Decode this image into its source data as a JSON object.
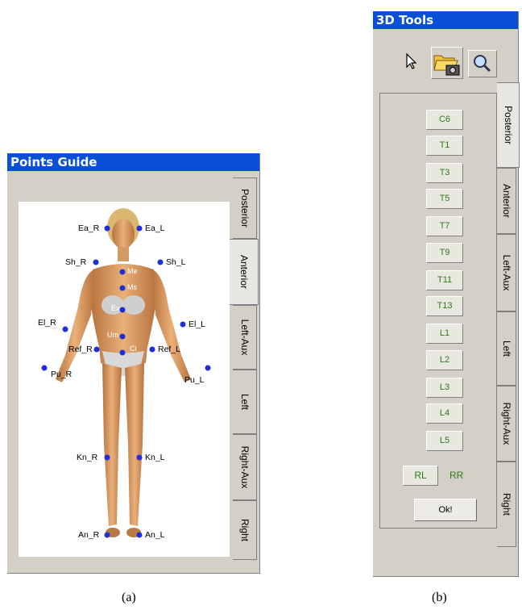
{
  "panel_a": {
    "title": "Points Guide",
    "tabs": [
      "Posterior",
      "Anterior",
      "Left-Aux",
      "Left",
      "Right-Aux",
      "Right"
    ],
    "active_tab": "Anterior",
    "point_labels": {
      "ea_r": "Ea_R",
      "ea_l": "Ea_L",
      "sh_r": "Sh_R",
      "sh_l": "Sh_L",
      "me": "Me",
      "ms": "Ms",
      "ex": "Ex",
      "el_r": "El_R",
      "el_l": "El_L",
      "um": "Um",
      "ci": "Ci",
      "ref_r": "Ref_R",
      "ref_l": "Ref_L",
      "pu_r": "Pu_R",
      "pu_l": "Pu_L",
      "kn_r": "Kn_R",
      "kn_l": "Kn_L",
      "an_r": "An_R",
      "an_l": "An_L"
    },
    "caption": "(a)"
  },
  "panel_b": {
    "title": "3D Tools",
    "toolbar": [
      "pointer-icon",
      "open-camera-icon",
      "magnifier-icon"
    ],
    "tabs": [
      "Posterior",
      "Anterior",
      "Left-Aux",
      "Left",
      "Right-Aux",
      "Right"
    ],
    "active_tab": "Posterior",
    "vertebrae": [
      "C6",
      "T1",
      "T3",
      "T5",
      "T7",
      "T9",
      "T11",
      "T13",
      "L1",
      "L2",
      "L3",
      "L4",
      "L5"
    ],
    "rl_label": "RL",
    "rr_label": "RR",
    "ok_label": "Ok!",
    "caption": "(b)"
  },
  "colors": {
    "title_bar": "#0a50d6",
    "point": "#1f2fd8",
    "button_text": "#2a7a1a",
    "panel": "#d4d0c8"
  }
}
